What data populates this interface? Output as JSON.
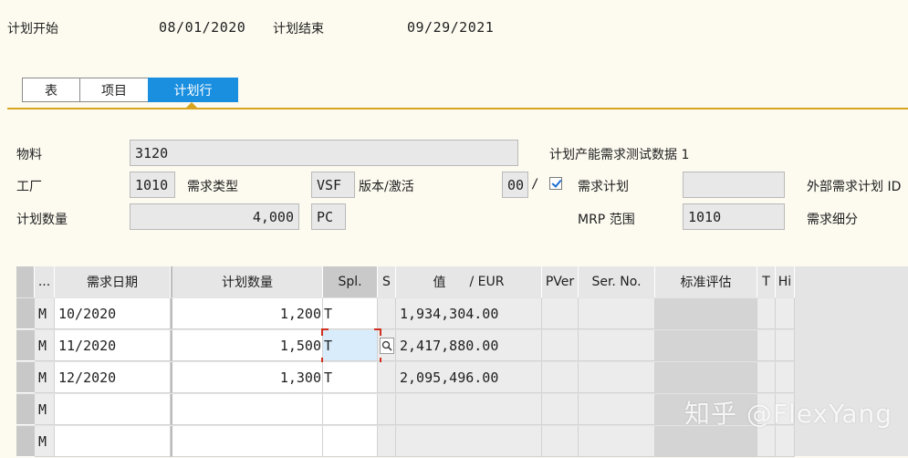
{
  "header": {
    "plan_start_label": "计划开始",
    "plan_start_value": "08/01/2020",
    "plan_end_label": "计划结束",
    "plan_end_value": "09/29/2021"
  },
  "tabs": [
    {
      "label": "表",
      "active": false
    },
    {
      "label": "项目",
      "active": false
    },
    {
      "label": "计划行",
      "active": true
    }
  ],
  "form": {
    "material_label": "物料",
    "material_value": "3120",
    "material_desc": "计划产能需求测试数据 1",
    "plant_label": "工厂",
    "plant_value": "1010",
    "req_type_label": "需求类型",
    "req_type_value": "VSF",
    "version_label": "版本/激活",
    "version_value": "00",
    "version_sep": "/",
    "req_plan_label": "需求计划",
    "req_plan_checked": true,
    "req_plan_value": "",
    "ext_req_label": "外部需求计划 ID",
    "plan_qty_label": "计划数量",
    "plan_qty_value": "4,000",
    "unit_value": "PC",
    "mrp_label": "MRP 范围",
    "mrp_value": "1010",
    "req_detail_label": "需求细分"
  },
  "table": {
    "columns": [
      "...",
      "需求日期",
      "计划数量",
      "Spl.",
      "S",
      "值",
      "/ EUR",
      "PVer",
      "Ser. No.",
      "标准评估",
      "T",
      "Hi"
    ],
    "rows": [
      {
        "m": "M",
        "date": "10/2020",
        "qty": "1,200",
        "spl": "T",
        "value": "1,934,304.00"
      },
      {
        "m": "M",
        "date": "11/2020",
        "qty": "1,500",
        "spl": "T",
        "value": "2,417,880.00"
      },
      {
        "m": "M",
        "date": "12/2020",
        "qty": "1,300",
        "spl": "T",
        "value": "2,095,496.00"
      },
      {
        "m": "M",
        "date": "",
        "qty": "",
        "spl": "",
        "value": ""
      },
      {
        "m": "M",
        "date": "",
        "qty": "",
        "spl": "",
        "value": ""
      }
    ]
  },
  "watermark": "知乎 @FlexYang",
  "colors": {
    "accent": "#1a8fe0",
    "rule": "#d9a520",
    "focus_corner": "#d03020"
  }
}
